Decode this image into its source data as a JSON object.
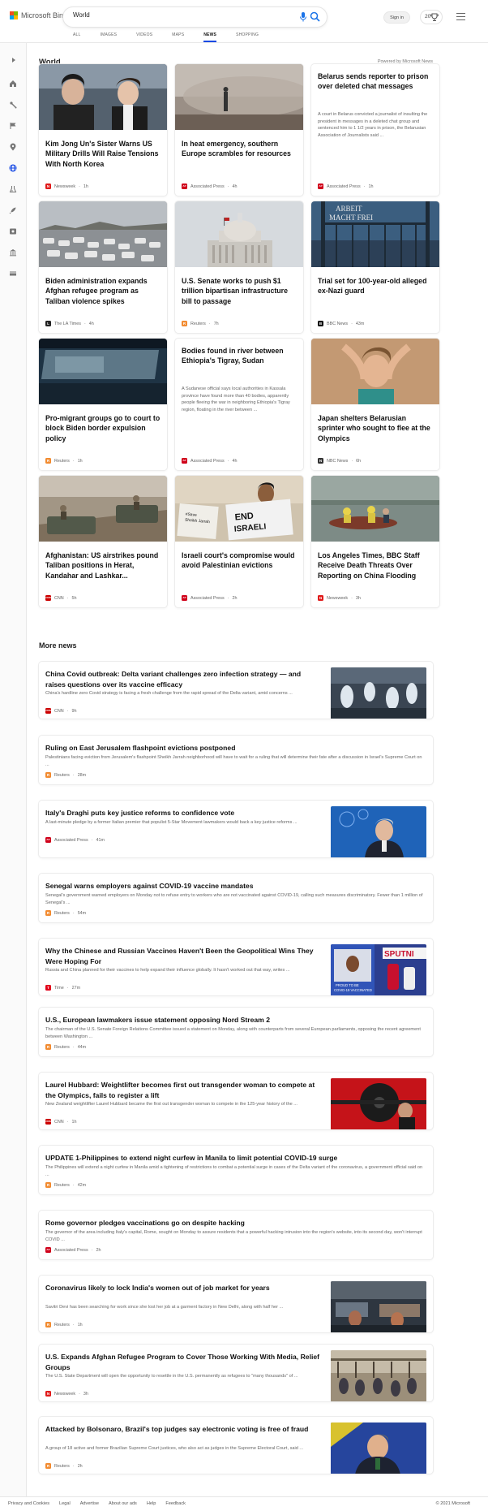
{
  "header": {
    "logo_text": "Microsoft Bing",
    "search_value": "World",
    "signin_label": "Sign in",
    "reward_count": "20",
    "tabs": [
      {
        "label": "ALL",
        "active": false
      },
      {
        "label": "IMAGES",
        "active": false
      },
      {
        "label": "VIDEOS",
        "active": false
      },
      {
        "label": "MAPS",
        "active": false
      },
      {
        "label": "NEWS",
        "active": true
      },
      {
        "label": "SHOPPING",
        "active": false
      }
    ]
  },
  "rail_icons": [
    "chevron-right-icon",
    "home-icon",
    "sports-icon",
    "flag-icon",
    "location-icon",
    "globe-icon",
    "science-icon",
    "rocket-icon",
    "entertainment-icon",
    "bank-icon",
    "money-icon"
  ],
  "section": {
    "title": "World",
    "powered_by": "Powered by Microsoft News"
  },
  "cards": [
    {
      "title": "Kim Jong Un's Sister Warns US Military Drills Will Raise Tensions With North Korea",
      "source": "Newsweek",
      "time": "1h",
      "badge": "N",
      "badge_color": "#e01a1a",
      "image": "kim"
    },
    {
      "title": "In heat emergency, southern Europe scrambles for resources",
      "source": "Associated Press",
      "time": "4h",
      "badge": "AP",
      "badge_color": "#d0021b",
      "image": "smoke"
    },
    {
      "title": "Belarus sends reporter to prison over deleted chat messages",
      "desc": "A court in Belarus convicted a journalist of insulting the president in messages in a deleted chat group and sentenced him to 1 1/2 years in prison, the Belarusian Association of Journalists said ...",
      "source": "Associated Press",
      "time": "1h",
      "badge": "AP",
      "badge_color": "#d0021b",
      "image": ""
    },
    {
      "title": "Biden administration expands Afghan refugee program as Taliban violence spikes",
      "source": "The LA Times",
      "time": "4h",
      "badge": "L",
      "badge_color": "#222222",
      "image": "cars"
    },
    {
      "title": "U.S. Senate works to push $1 trillion bipartisan infrastructure bill to passage",
      "source": "Reuters",
      "time": "7h",
      "badge": "R",
      "badge_color": "#f28b30",
      "image": "capitol"
    },
    {
      "title": "Trial set for 100-year-old alleged ex-Nazi guard",
      "source": "BBC News",
      "time": "43m",
      "badge": "B",
      "badge_color": "#111111",
      "image": "gate",
      "gate_text": "ARBEIT MACHT FREI"
    },
    {
      "title": "Pro-migrant groups go to court to block Biden border expulsion policy",
      "source": "Reuters",
      "time": "1h",
      "badge": "R",
      "badge_color": "#f28b30",
      "image": "car"
    },
    {
      "title": "Bodies found in river between Ethiopia's Tigray, Sudan",
      "desc": "A Sudanese official says local authorities in Kassala province have found more than 40 bodies, apparently people fleeing the war in neighboring Ethiopia's Tigray region, floating in the river between ...",
      "source": "Associated Press",
      "time": "4h",
      "badge": "AP",
      "badge_color": "#d0021b",
      "image": ""
    },
    {
      "title": "Japan shelters Belarusian sprinter who sought to flee at the Olympics",
      "source": "NBC News",
      "time": "6h",
      "badge": "N",
      "badge_color": "#333333",
      "image": "athlete"
    },
    {
      "title": "Afghanistan: US airstrikes pound Taliban positions in Herat, Kandahar and Lashkar...",
      "source": "CNN",
      "time": "5h",
      "badge": "CNN",
      "badge_color": "#cc0000",
      "image": "soldiers"
    },
    {
      "title": "Israeli court's compromise would avoid Palestinian evictions",
      "source": "Associated Press",
      "time": "2h",
      "badge": "AP",
      "badge_color": "#d0021b",
      "image": "protest",
      "sign_text": "END ISRAELI",
      "sign_small": "#Save Sheikh Jarrah"
    },
    {
      "title": "Los Angeles Times, BBC Staff Receive Death Threats Over Reporting on China Flooding",
      "source": "Newsweek",
      "time": "3h",
      "badge": "N",
      "badge_color": "#e01a1a",
      "image": "flood"
    }
  ],
  "more_news": {
    "title": "More news",
    "items": [
      {
        "title": "China Covid outbreak: Delta variant challenges zero infection strategy — and raises questions over its vaccine efficacy",
        "desc": "China's hardline zero Covid strategy is facing a fresh challenge from the rapid spread of the Delta variant, amid concerns ...",
        "source": "CNN",
        "time": "9h",
        "badge": "CNN",
        "badge_color": "#cc0000",
        "image": "covid"
      },
      {
        "title": "Ruling on East Jerusalem flashpoint evictions postponed",
        "desc": "Palestinians facing eviction from Jerusalem's flashpoint Sheikh Jarrah neighborhood will have to wait for a ruling that will determine their fate after a discussion in Israel's Supreme Court on ...",
        "source": "Reuters",
        "time": "28m",
        "badge": "R",
        "badge_color": "#f28b30",
        "image": ""
      },
      {
        "title": "Italy's Draghi puts key justice reforms to confidence vote",
        "desc": "A last-minute pledge by a former Italian premier that populist 5-Star Movement lawmakers would back a key justice reforms ...",
        "source": "Associated Press",
        "time": "41m",
        "badge": "AP",
        "badge_color": "#d0021b",
        "image": "draghi"
      },
      {
        "title": "Senegal warns employers against COVID-19 vaccine mandates",
        "desc": "Senegal's government warned employers on Monday not to refuse entry to workers who are not vaccinated against COVID-19, calling such measures discriminatory. Fewer than 1 million of Senegal's ...",
        "source": "Reuters",
        "time": "54m",
        "badge": "R",
        "badge_color": "#f28b30",
        "image": ""
      },
      {
        "title": "Why the Chinese and Russian Vaccines Haven't Been the Geopolitical Wins They Were Hoping For",
        "desc": "Russia and China planned for their vaccines to help expand their influence globally. It hasn't worked out that way, writes ...",
        "source": "Time",
        "time": "27m",
        "badge": "T",
        "badge_color": "#e2001a",
        "image": "sputnik",
        "img_text": "SPUTNI",
        "img_caption": "PROUD TO BE COVID-19 VACCINATED"
      },
      {
        "title": "U.S., European lawmakers issue statement opposing Nord Stream 2",
        "desc": "The chairman of the U.S. Senate Foreign Relations Committee issued a statement on Monday, along with counterparts from several European parliaments, opposing the recent agreement between Washington ...",
        "source": "Reuters",
        "time": "44m",
        "badge": "R",
        "badge_color": "#f28b30",
        "image": ""
      },
      {
        "title": "Laurel Hubbard: Weightlifter becomes first out transgender woman to compete at the Olympics, fails to register a lift",
        "desc": "New Zealand weightlifter Laurel Hubbard became the first out transgender woman to compete in the 125-year history of the ...",
        "source": "CNN",
        "time": "1h",
        "badge": "CNN",
        "badge_color": "#cc0000",
        "image": "lifter"
      },
      {
        "title": "UPDATE 1-Philippines to extend night curfew in Manila to limit potential COVID-19 surge",
        "desc": "The Philippines will extend a night curfew in Manila amid a tightening of restrictions to combat a potential surge in cases of the Delta variant of the coronavirus, a government official said on ...",
        "source": "Reuters",
        "time": "42m",
        "badge": "R",
        "badge_color": "#f28b30",
        "image": ""
      },
      {
        "title": "Rome governor pledges vaccinations go on despite hacking",
        "desc": "The governor of the area including Italy's capital, Rome, sought on Monday to assure residents that a powerful hacking intrusion into the region's website, into its second day, won't interrupt COVID ...",
        "source": "Associated Press",
        "time": "2h",
        "badge": "AP",
        "badge_color": "#d0021b",
        "image": ""
      },
      {
        "title": "Coronavirus likely to lock India's women out of job market for years",
        "desc": "Savitri Devi has been searching for work since she lost her job at a garment factory in New Delhi, along with half her ...",
        "source": "Reuters",
        "time": "1h",
        "badge": "R",
        "badge_color": "#f28b30",
        "image": "india"
      },
      {
        "title": "U.S. Expands Afghan Refugee Program to Cover Those Working With Media, Relief Groups",
        "desc": "The U.S. State Department will open the opportunity to resettle in the U.S. permanently as refugees to \"many thousands\" of ...",
        "source": "Newsweek",
        "time": "3h",
        "badge": "N",
        "badge_color": "#e01a1a",
        "image": "refugees"
      },
      {
        "title": "Attacked by Bolsonaro, Brazil's top judges say electronic voting is free of fraud",
        "desc": "A group of 18 active and former Brazilian Supreme Court justices, who also act as judges in the Supreme Electoral Court, said ...",
        "source": "Reuters",
        "time": "2h",
        "badge": "R",
        "badge_color": "#f28b30",
        "image": "bolsonaro"
      }
    ]
  },
  "footer": {
    "links": [
      "Privacy and Cookies",
      "Legal",
      "Advertise",
      "About our ads",
      "Help",
      "Feedback"
    ],
    "copyright": "© 2021 Microsoft"
  },
  "colors": {
    "accent": "#174ae4",
    "tab_underline": "#174ae4"
  }
}
